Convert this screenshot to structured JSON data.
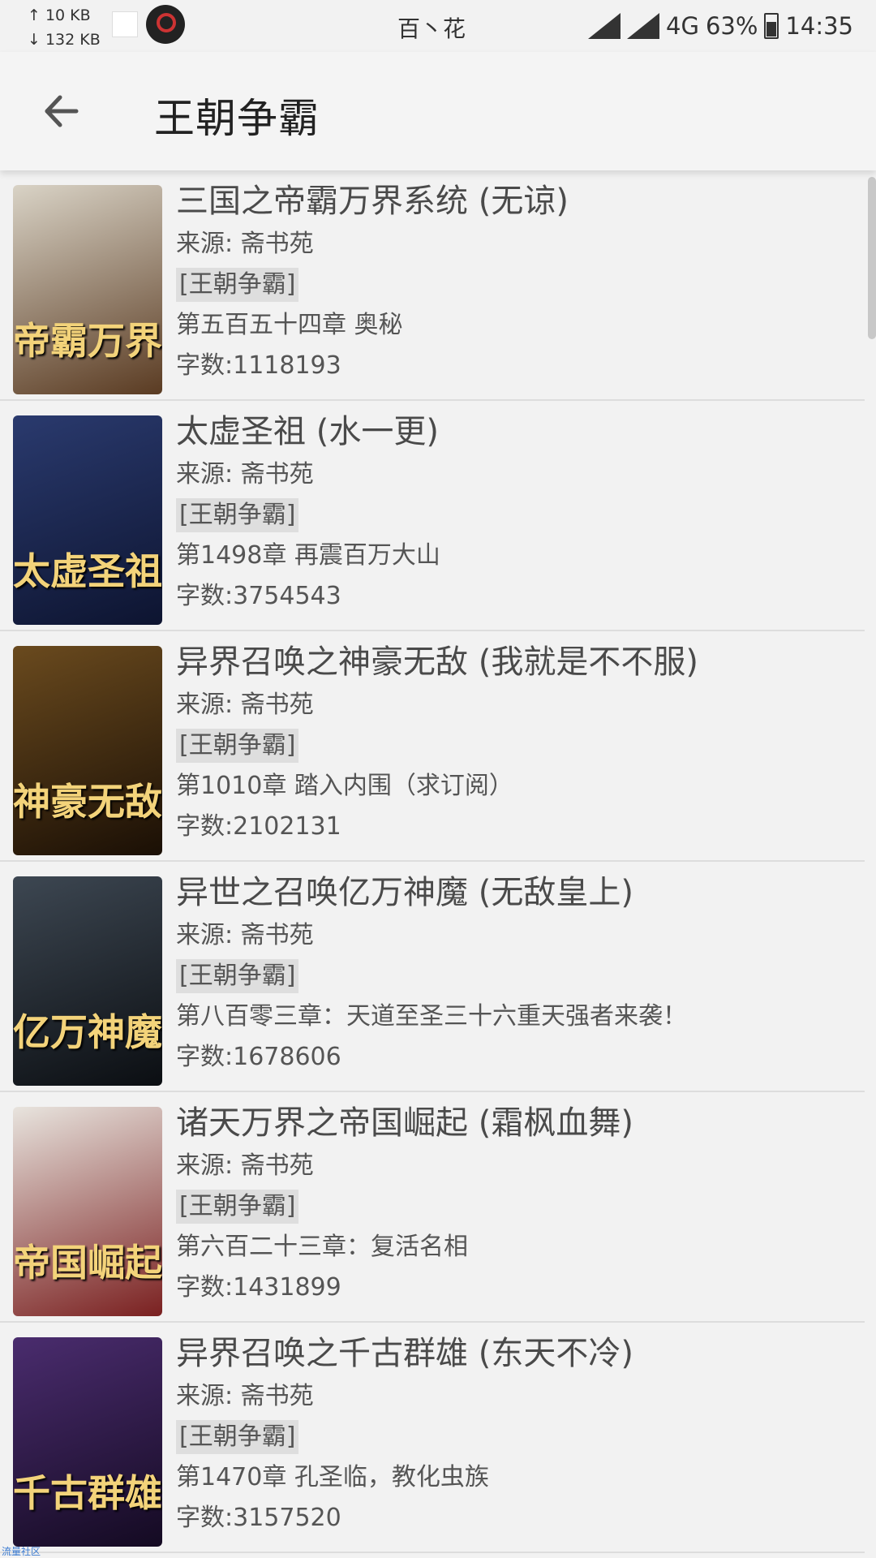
{
  "status_bar": {
    "upload": "↑ 10 KB",
    "download": "↓ 132 KB",
    "carrier": "百丶花",
    "network": "4G",
    "battery": "63%",
    "time": "14:35"
  },
  "app_bar": {
    "back_icon": "arrow-left-icon",
    "title": "王朝争霸"
  },
  "books": [
    {
      "title": "三国之帝霸万界系统 (无谅)",
      "source": "来源: 斋书苑",
      "tag": "[王朝争霸]",
      "chapter": "第五百五十四章 奥秘",
      "words": "字数:1118193",
      "cover_text": "帝霸万界",
      "cover_colors": [
        "#d9d3c6",
        "#5a3b22"
      ]
    },
    {
      "title": "太虚圣祖 (水一更)",
      "source": "来源: 斋书苑",
      "tag": "[王朝争霸]",
      "chapter": "第1498章 再震百万大山",
      "words": "字数:3754543",
      "cover_text": "太虚圣祖",
      "cover_colors": [
        "#2a3a6e",
        "#0d1430"
      ]
    },
    {
      "title": "异界召唤之神豪无敌 (我就是不不服)",
      "source": "来源: 斋书苑",
      "tag": "[王朝争霸]",
      "chapter": "第1010章 踏入内围（求订阅）",
      "words": "字数:2102131",
      "cover_text": "神豪无敌",
      "cover_colors": [
        "#6a4a1e",
        "#1a0f05"
      ]
    },
    {
      "title": "异世之召唤亿万神魔 (无敌皇上)",
      "source": "来源: 斋书苑",
      "tag": "[王朝争霸]",
      "chapter": "第八百零三章：天道至圣三十六重天强者来袭！",
      "words": "字数:1678606",
      "cover_text": "亿万神魔",
      "cover_colors": [
        "#3d4752",
        "#0b0e12"
      ]
    },
    {
      "title": "诸天万界之帝国崛起 (霜枫血舞)",
      "source": "来源: 斋书苑",
      "tag": "[王朝争霸]",
      "chapter": "第六百二十三章：复活名相",
      "words": "字数:1431899",
      "cover_text": "帝国崛起",
      "cover_colors": [
        "#e8e4de",
        "#7a2020"
      ]
    },
    {
      "title": "异界召唤之千古群雄 (东天不冷)",
      "source": "来源: 斋书苑",
      "tag": "[王朝争霸]",
      "chapter": "第1470章 孔圣临，教化虫族",
      "words": "字数:3157520",
      "cover_text": "千古群雄",
      "cover_colors": [
        "#4a2c6e",
        "#140a22"
      ]
    }
  ],
  "watermark": "流量社区"
}
